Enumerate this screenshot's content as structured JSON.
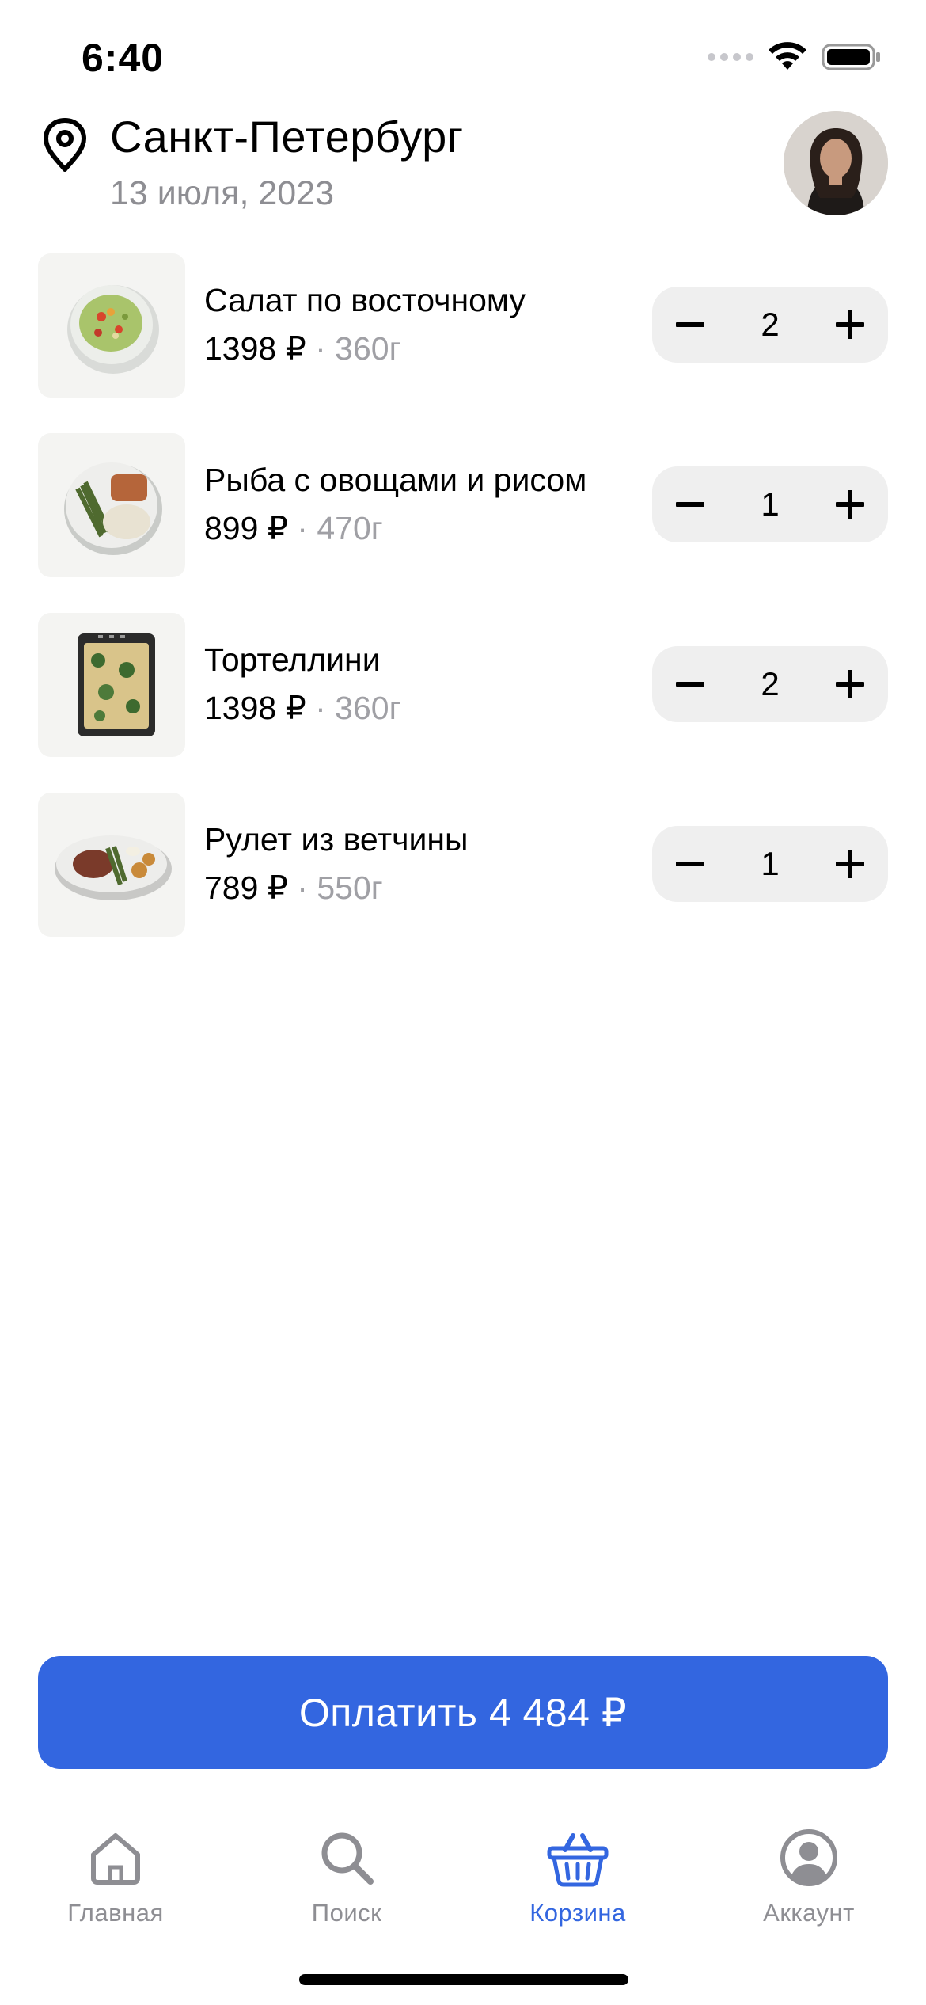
{
  "status_bar": {
    "time": "6:40"
  },
  "header": {
    "city": "Санкт-Петербург",
    "date": "13 июля, 2023",
    "icon": "location-pin-icon"
  },
  "cart": {
    "items": [
      {
        "name": "Салат по восточному",
        "price": "1398 ₽",
        "separator": "·",
        "weight": "360г",
        "quantity": "2",
        "image": "salad"
      },
      {
        "name": "Рыба с овощами и рисом",
        "price": "899 ₽",
        "separator": "·",
        "weight": "470г",
        "quantity": "1",
        "image": "fish-plate"
      },
      {
        "name": "Тортеллини",
        "price": "1398 ₽",
        "separator": "·",
        "weight": "360г",
        "quantity": "2",
        "image": "tortellini-tray"
      },
      {
        "name": "Рулет из ветчины",
        "price": "789 ₽",
        "separator": "·",
        "weight": "550г",
        "quantity": "1",
        "image": "ham-roll-plate"
      }
    ]
  },
  "pay_button": {
    "label": "Оплатить 4 484 ₽"
  },
  "tab_bar": {
    "tabs": [
      {
        "label": "Главная",
        "icon": "home-icon",
        "active": false
      },
      {
        "label": "Поиск",
        "icon": "search-icon",
        "active": false
      },
      {
        "label": "Корзина",
        "icon": "basket-icon",
        "active": true
      },
      {
        "label": "Аккаунт",
        "icon": "account-icon",
        "active": false
      }
    ]
  },
  "colors": {
    "accent": "#3366e0",
    "muted": "#8e8e93",
    "stepper_bg": "#efefef"
  }
}
